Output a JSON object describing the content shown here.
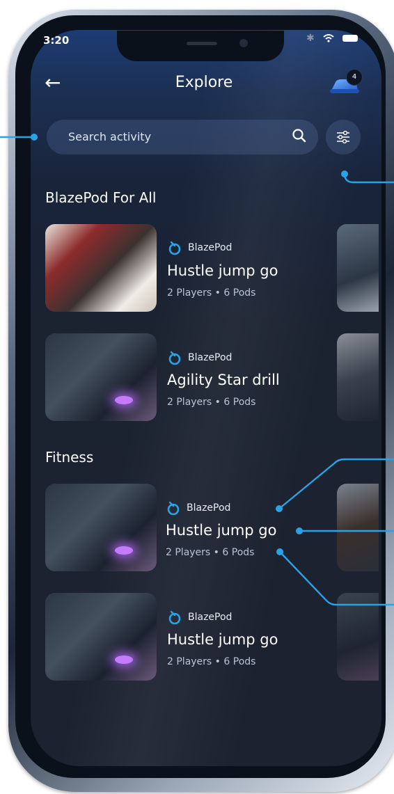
{
  "status_bar": {
    "time": "3:20",
    "icons": [
      "bluetooth-icon",
      "wifi-icon",
      "battery-icon"
    ]
  },
  "header": {
    "title": "Explore",
    "back_icon": "arrow-left-icon",
    "pod_count": "4"
  },
  "search": {
    "placeholder": "Search activity"
  },
  "sections": [
    {
      "title": "BlazePod For All",
      "cards": [
        {
          "brand": "BlazePod",
          "title": "Hustle jump go",
          "players": "2 Players",
          "pods": "6 Pods"
        },
        {
          "brand": "BlazePod",
          "title": "Agility Star drill",
          "players": "2 Players",
          "pods": "6 Pods"
        }
      ]
    },
    {
      "title": "Fitness",
      "cards": [
        {
          "brand": "BlazePod",
          "title": "Hustle jump go",
          "players": "2 Players",
          "pods": "6 Pods"
        },
        {
          "brand": "BlazePod",
          "title": "Hustle jump go",
          "players": "2 Players",
          "pods": "6 Pods"
        }
      ]
    }
  ],
  "colors": {
    "accent": "#2aa3e6",
    "background": "#1b2230",
    "header_gradient": "#1d3c74"
  }
}
